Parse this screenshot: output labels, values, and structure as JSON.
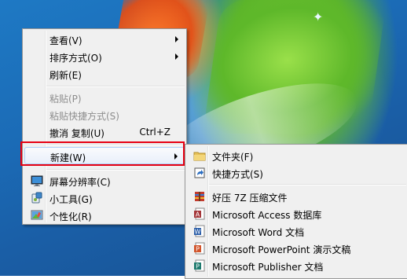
{
  "context_menu": {
    "items": [
      {
        "label": "查看(V)",
        "submenu": true
      },
      {
        "label": "排序方式(O)",
        "submenu": true
      },
      {
        "label": "刷新(E)"
      },
      {
        "label": "粘贴(P)",
        "disabled": true
      },
      {
        "label": "粘贴快捷方式(S)",
        "disabled": true
      },
      {
        "label": "撤消 复制(U)",
        "accelerator": "Ctrl+Z"
      },
      {
        "label": "新建(W)",
        "submenu": true,
        "highlighted": true
      },
      {
        "label": "屏幕分辨率(C)",
        "icon": "screen-resolution-icon"
      },
      {
        "label": "小工具(G)",
        "icon": "gadgets-icon"
      },
      {
        "label": "个性化(R)",
        "icon": "personalize-icon"
      }
    ]
  },
  "new_submenu": {
    "items": [
      {
        "label": "文件夹(F)",
        "icon": "folder-icon"
      },
      {
        "label": "快捷方式(S)",
        "icon": "shortcut-icon"
      },
      {
        "label": "好压 7Z 压缩文件",
        "icon": "archive-icon"
      },
      {
        "label": "Microsoft Access 数据库",
        "icon": "access-icon"
      },
      {
        "label": "Microsoft Word 文档",
        "icon": "word-icon"
      },
      {
        "label": "Microsoft PowerPoint 演示文稿",
        "icon": "powerpoint-icon"
      },
      {
        "label": "Microsoft Publisher 文档",
        "icon": "publisher-icon"
      }
    ]
  },
  "colors": {
    "highlight_box": "#e60012",
    "menu_bg": "#f0f0f0"
  }
}
